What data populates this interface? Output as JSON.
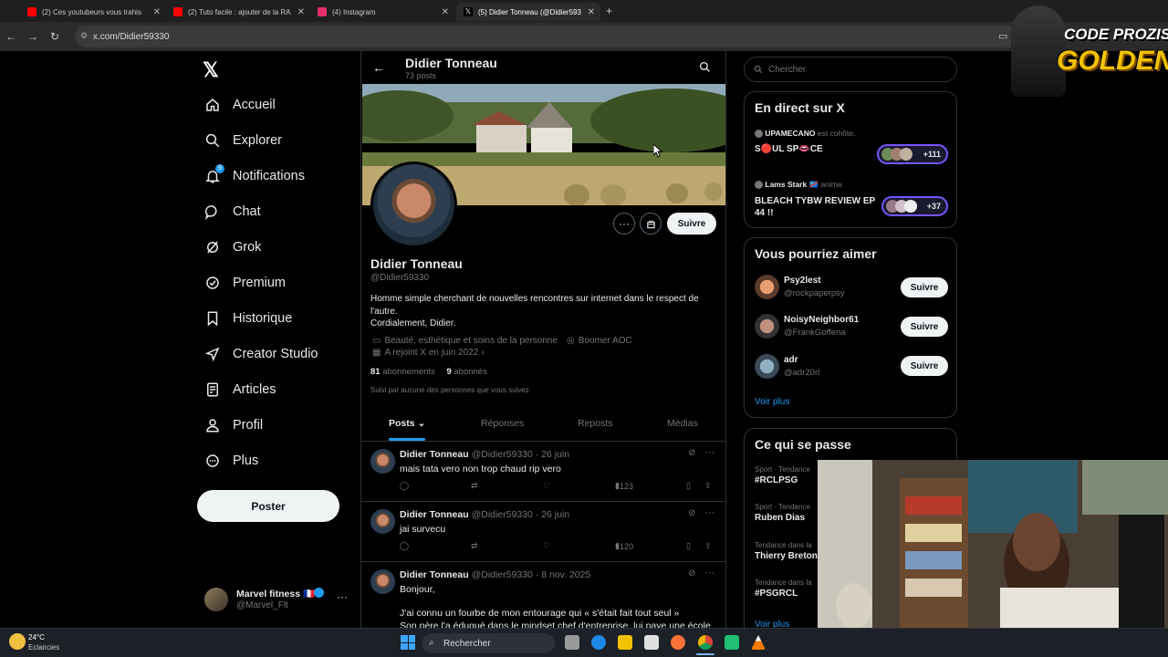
{
  "browser": {
    "tabs": [
      {
        "title": "(2) Ces youtubeurs vous trahis",
        "color": "#ff0000"
      },
      {
        "title": "(2) Tuto facile : ajouter de la RA",
        "color": "#ff0000"
      },
      {
        "title": "(4) Instagram",
        "color": "#e1306c"
      },
      {
        "title": "(5) Didier Tonneau (@Didier593",
        "color": "#ffffff"
      }
    ],
    "url": "x.com/Didier59330"
  },
  "sidebar": {
    "logo": "𝕏",
    "items": [
      {
        "label": "Accueil",
        "icon": "home-icon"
      },
      {
        "label": "Explorer",
        "icon": "search-icon"
      },
      {
        "label": "Notifications",
        "icon": "bell-icon",
        "badge": "9"
      },
      {
        "label": "Chat",
        "icon": "chat-icon"
      },
      {
        "label": "Grok",
        "icon": "grok-icon"
      },
      {
        "label": "Premium",
        "icon": "verified-icon"
      },
      {
        "label": "Historique",
        "icon": "bookmark-icon"
      },
      {
        "label": "Creator Studio",
        "icon": "rocket-icon"
      },
      {
        "label": "Articles",
        "icon": "article-icon"
      },
      {
        "label": "Profil",
        "icon": "person-icon"
      },
      {
        "label": "Plus",
        "icon": "more-circle-icon"
      }
    ],
    "post_button": "Poster",
    "account": {
      "name": "Marvel fitness 🇫🇷",
      "handle": "@Marvel_Flt"
    }
  },
  "profile": {
    "header_name": "Didier Tonneau",
    "header_posts": "73 posts",
    "name": "Didier Tonneau",
    "handle": "@Didier59330",
    "bio_line1": "Homme simple cherchant de nouvelles rencontres sur internet dans le respect de",
    "bio_line2": "l'autre.",
    "bio_line3": "Cordialement, Didier.",
    "category": "Beauté, esthétique et soins de la personne",
    "location": "Boomer AOC",
    "joined": "A rejoint X en juin 2022",
    "following_count": "81",
    "following_label": "abonnements",
    "followers_count": "9",
    "followers_label": "abonnés",
    "followed_by": "Suivi par aucune des personnes que vous suivez",
    "follow_button": "Suivre",
    "tabs": [
      "Posts",
      "Réponses",
      "Reposts",
      "Médias"
    ]
  },
  "tweets": [
    {
      "name": "Didier Tonneau",
      "meta": "@Didier59330 · 26 juin",
      "text": "mais tata vero non trop chaud rip vero",
      "views": "123"
    },
    {
      "name": "Didier Tonneau",
      "meta": "@Didier59330 · 26 juin",
      "text": "jai survecu",
      "views": "120"
    },
    {
      "name": "Didier Tonneau",
      "meta": "@Didier59330 · 8 nov. 2025",
      "text1": "Bonjour,",
      "text2": "J'ai connu un fourbe de mon entourage qui « s'était fait tout seul »",
      "text3": "Son père l'a éduqué dans le mindset chef d'entreprise, lui paye une école"
    }
  ],
  "right": {
    "search_placeholder": "Chercher",
    "live_title": "En direct sur X",
    "live": [
      {
        "host": "UPAMECANO",
        "action": "est cohôte.",
        "title": "S🔴UL SP👄CE",
        "count": "+111"
      },
      {
        "host": "Lams Stark 🇨🇩",
        "action": "anime.",
        "title": "BLEACH TYBW REVIEW EP 44 !!",
        "count": "+37"
      }
    ],
    "suggest_title": "Vous pourriez aimer",
    "suggestions": [
      {
        "name": "Psy2lest",
        "handle": "@rockpaperpsy",
        "button": "Suivre"
      },
      {
        "name": "NoisyNeighbor61",
        "handle": "@FrankGoffena",
        "button": "Suivre"
      },
      {
        "name": "adr",
        "handle": "@adr20rl",
        "button": "Suivre"
      }
    ],
    "see_more": "Voir plus",
    "trends_title": "Ce qui se passe",
    "trends": [
      {
        "context": "Sport · Tendance",
        "name": "#RCLPSG"
      },
      {
        "context": "Sport · Tendance",
        "name": "Ruben Dias"
      },
      {
        "context": "Tendance dans la",
        "name": "Thierry Breton"
      },
      {
        "context": "Tendance dans la",
        "name": "#PSGRCL"
      }
    ],
    "trends_more": "Voir plus"
  },
  "overlay": {
    "line1": "CODE PROZIS",
    "line2": "GOLDENG"
  },
  "taskbar": {
    "temp": "24°C",
    "weather": "Eclaircies",
    "search": "Rechercher"
  }
}
